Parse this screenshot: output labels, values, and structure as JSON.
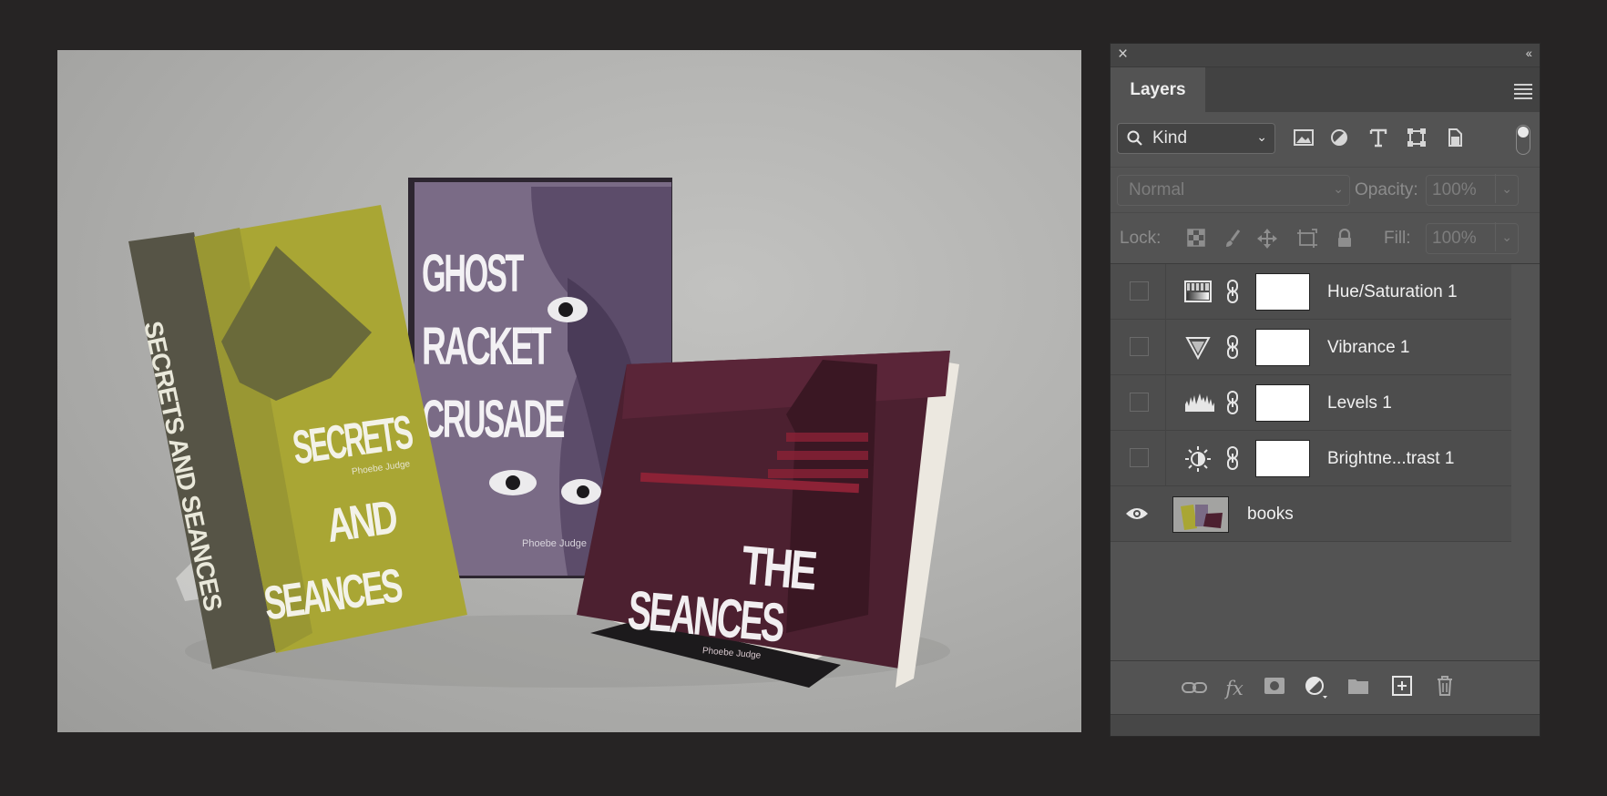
{
  "canvas": {
    "book1": {
      "title_line1": "SECRETS",
      "title_line2": "AND",
      "title_line3": "SEANCES",
      "author": "Phoebe Judge",
      "spine": "SECRETS AND SEANCES"
    },
    "book2": {
      "title_line1": "GHOST",
      "title_line2": "RACKET",
      "title_line3": "CRUSADE",
      "author": "Phoebe Judge"
    },
    "book3": {
      "title_line1": "THE",
      "title_line2": "SEANCES",
      "author": "Phoebe Judge"
    }
  },
  "panel": {
    "close_glyph": "×",
    "collapse_glyph": "‹‹",
    "tab_label": "Layers",
    "filter": {
      "search_glyph": "⚲",
      "kind_label": "Kind",
      "chevron": "⌄"
    },
    "blend_mode": "Normal",
    "opacity_label": "Opacity:",
    "opacity_value": "100%",
    "lock_label": "Lock:",
    "fill_label": "Fill:",
    "fill_value": "100%",
    "layers": [
      {
        "name": "Hue/Saturation 1",
        "icon": "hue-saturation-icon",
        "visible": false
      },
      {
        "name": "Vibrance 1",
        "icon": "vibrance-icon",
        "visible": false
      },
      {
        "name": "Levels 1",
        "icon": "levels-icon",
        "visible": false
      },
      {
        "name": "Brightne...trast 1",
        "icon": "brightness-contrast-icon",
        "visible": false
      },
      {
        "name": "books",
        "icon": "image-thumbnail",
        "visible": true
      }
    ],
    "bottom_icons": [
      "link-icon",
      "fx-icon",
      "mask-icon",
      "adjustment-icon",
      "folder-icon",
      "new-layer-icon",
      "trash-icon"
    ],
    "fx_label": "fx"
  }
}
